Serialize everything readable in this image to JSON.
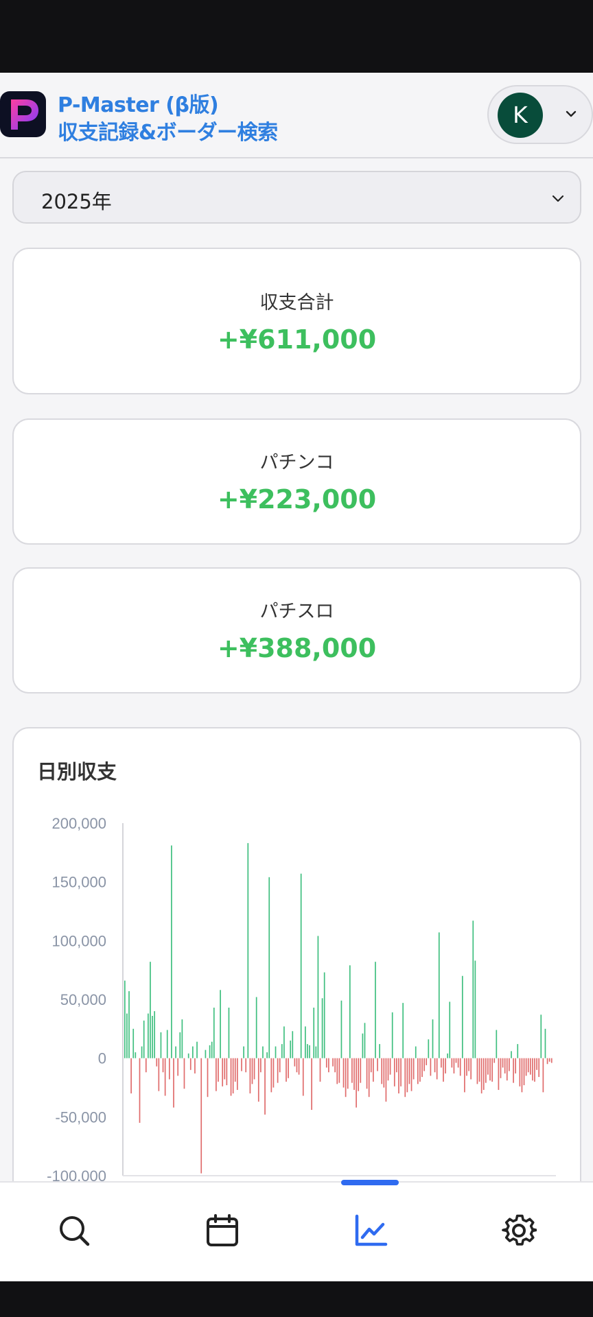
{
  "header": {
    "logo_letter": "P",
    "title_line1": "P-Master (β版)",
    "title_line2": "収支記録&ボーダー検索",
    "avatar_initial": "K"
  },
  "year_select": {
    "value": "2025年"
  },
  "summary": [
    {
      "label": "収支合計",
      "value": "+¥611,000"
    },
    {
      "label": "パチンコ",
      "value": "+¥223,000"
    },
    {
      "label": "パチスロ",
      "value": "+¥388,000"
    }
  ],
  "chart": {
    "title": "日別収支"
  },
  "chart_data": {
    "type": "bar",
    "title": "日別収支",
    "ylim": [
      -100000,
      200000
    ],
    "yticks": [
      200000,
      150000,
      100000,
      50000,
      0,
      -50000,
      -100000
    ],
    "ytick_labels": [
      "200,000",
      "150,000",
      "100,000",
      "50,000",
      "0",
      "-50,000",
      "-100,000"
    ],
    "grid": false,
    "positive_color": "#3fbf7f",
    "negative_color": "#e06b6b",
    "values": [
      66000,
      38000,
      57000,
      -30000,
      25000,
      5000,
      0,
      -55000,
      10000,
      32000,
      -12000,
      38000,
      82000,
      36000,
      40000,
      -7000,
      -28000,
      22000,
      -12000,
      -32000,
      24000,
      -18000,
      181000,
      -42000,
      10000,
      -15000,
      22000,
      33000,
      -26000,
      0,
      4000,
      -10000,
      10000,
      -13000,
      14000,
      0,
      -98000,
      0,
      7000,
      -33000,
      11000,
      14000,
      43000,
      -28000,
      -20000,
      58000,
      -24000,
      -18000,
      -23000,
      43000,
      -32000,
      -30000,
      -20000,
      -27000,
      0,
      -11000,
      10000,
      -12000,
      183000,
      -30000,
      -22000,
      -18000,
      52000,
      -37000,
      -12000,
      10000,
      -48000,
      5000,
      154000,
      -29000,
      -25000,
      10000,
      -21000,
      -12000,
      12000,
      27000,
      -20000,
      -17000,
      15000,
      23000,
      -7000,
      -12000,
      -14000,
      157000,
      -32000,
      27000,
      12000,
      11000,
      -44000,
      43000,
      10000,
      104000,
      -20000,
      51000,
      73000,
      -8000,
      -12000,
      0,
      -7000,
      -12000,
      -22000,
      -21000,
      49000,
      -25000,
      -33000,
      -26000,
      79000,
      -21000,
      -27000,
      -42000,
      -28000,
      -21000,
      21000,
      30000,
      -26000,
      -33000,
      -12000,
      -20000,
      82000,
      -11000,
      12000,
      -22000,
      -25000,
      -37000,
      -19000,
      -14000,
      39000,
      -24000,
      -12000,
      -30000,
      -24000,
      47000,
      -33000,
      -29000,
      -22000,
      -28000,
      -18000,
      10000,
      -22000,
      -20000,
      -16000,
      -11000,
      -6000,
      16000,
      -15000,
      33000,
      -12000,
      -18000,
      107000,
      -8000,
      -20000,
      -13000,
      4000,
      48000,
      -8000,
      -13000,
      -4000,
      -8000,
      -15000,
      70000,
      -29000,
      -15000,
      -11000,
      -18000,
      117000,
      83000,
      -22000,
      -20000,
      -30000,
      -27000,
      -21000,
      -14000,
      -19000,
      -20000,
      -4000,
      24000,
      -27000,
      -17000,
      -8000,
      -13000,
      -19000,
      -11000,
      6000,
      -21000,
      -13000,
      12000,
      -24000,
      -29000,
      -23000,
      -15000,
      -12000,
      -14000,
      -19000,
      -20000,
      -10000,
      -16000,
      37000,
      -29000,
      25000,
      -5000,
      -3000,
      -4000
    ]
  },
  "bottom_nav": [
    {
      "name": "search",
      "icon": "search-icon",
      "active": false
    },
    {
      "name": "calendar",
      "icon": "calendar-icon",
      "active": false
    },
    {
      "name": "chart",
      "icon": "line-chart-icon",
      "active": true
    },
    {
      "name": "settings",
      "icon": "gear-icon",
      "active": false
    }
  ],
  "colors": {
    "accent": "#2f7fe0",
    "positive": "#3dbf5e",
    "nav_active": "#2f6bf0"
  }
}
